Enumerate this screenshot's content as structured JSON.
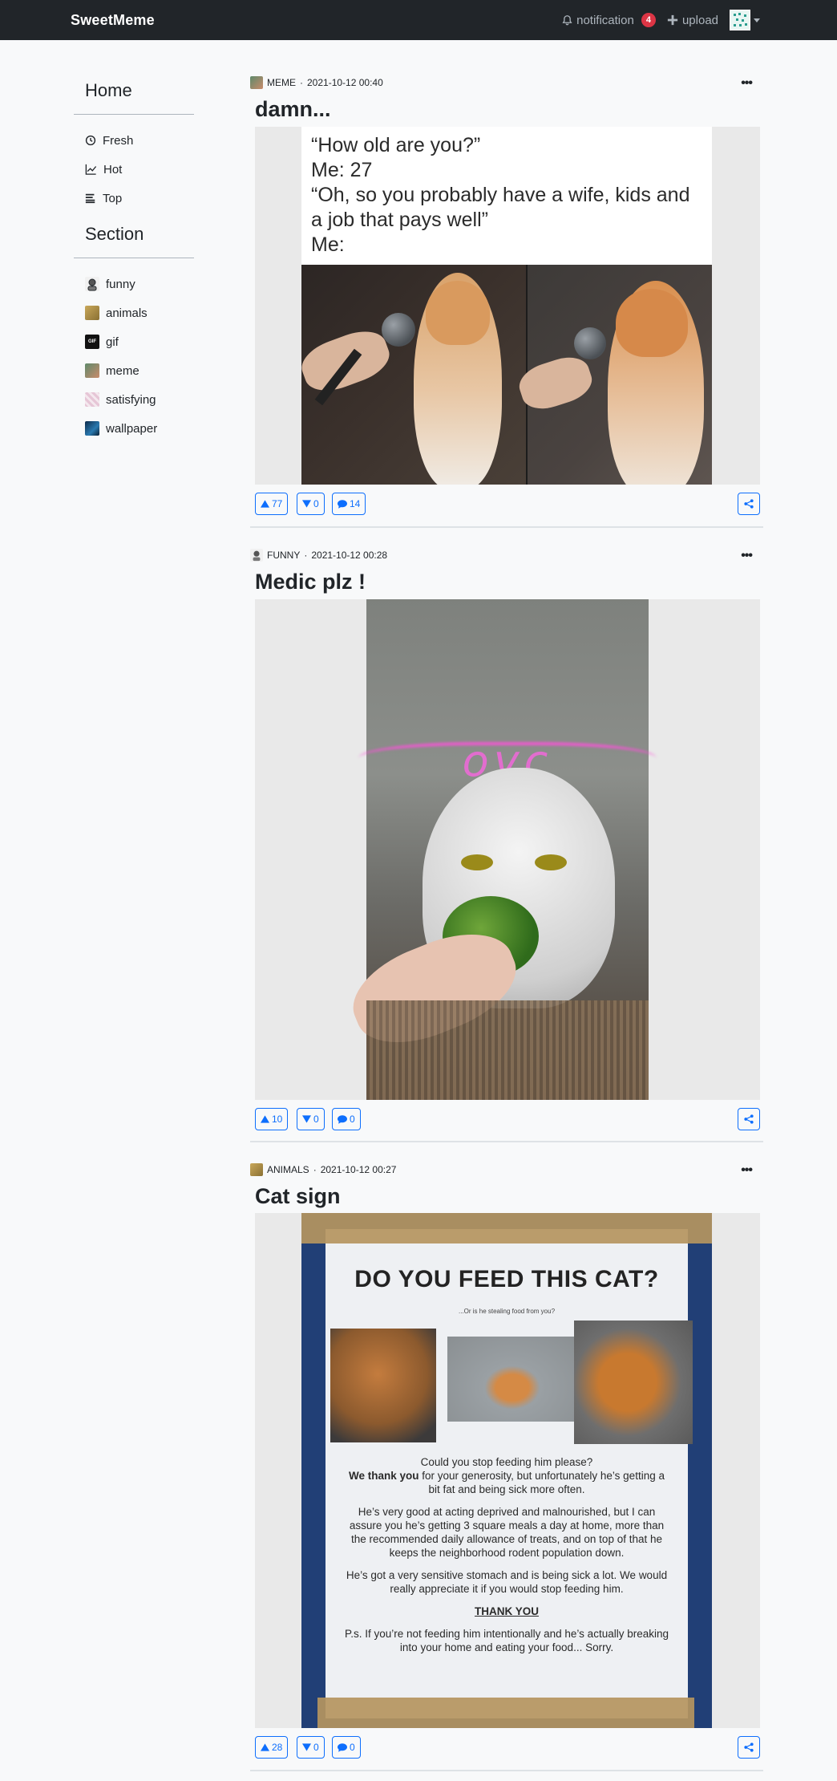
{
  "navbar": {
    "brand": "SweetMeme",
    "notification_label": "notification",
    "notification_count": "4",
    "upload_label": "upload"
  },
  "sidebar": {
    "home_heading": "Home",
    "home_items": [
      {
        "label": "Fresh",
        "icon": "clock-icon"
      },
      {
        "label": "Hot",
        "icon": "chart-line-icon"
      },
      {
        "label": "Top",
        "icon": "list-icon"
      }
    ],
    "section_heading": "Section",
    "sections": [
      {
        "label": "funny",
        "color": "#d9d9d9"
      },
      {
        "label": "animals",
        "color": "#c9a85a"
      },
      {
        "label": "gif",
        "color": "#111111"
      },
      {
        "label": "meme",
        "color": "#5f8a6b"
      },
      {
        "label": "satisfying",
        "color": "#e6c6d6"
      },
      {
        "label": "wallpaper",
        "color": "#1f4f7a"
      }
    ]
  },
  "posts": [
    {
      "section": "MEME",
      "section_color": "#5f8a6b",
      "date": "2021-10-12 00:40",
      "title": "damn...",
      "upvotes": "77",
      "downvotes": "0",
      "comments": "14",
      "meme_lines": [
        "“How old are you?”",
        "Me: 27",
        "“Oh, so you probably have a wife, kids and",
        "a job that pays well”",
        "Me:"
      ]
    },
    {
      "section": "FUNNY",
      "section_color": "#d9d9d9",
      "date": "2021-10-12 00:28",
      "title": "Medic plz !",
      "upvotes": "10",
      "downvotes": "0",
      "comments": "0"
    },
    {
      "section": "ANIMALS",
      "section_color": "#c9a85a",
      "date": "2021-10-12 00:27",
      "title": "Cat sign",
      "upvotes": "28",
      "downvotes": "0",
      "comments": "0",
      "sign": {
        "heading": "DO YOU FEED THIS CAT?",
        "subheading": "...Or is he stealing food from you?",
        "para1_a": "Could you stop feeding him please?",
        "para1_bold": "We thank you",
        "para1_b": " for your generosity, but unfortunately he’s getting a bit fat and being sick more often.",
        "para2": "He’s very good at acting deprived and malnourished, but I can assure you he’s getting 3 square meals a day at home, more than the recommended daily allowance of treats, and on top of that he keeps the neighborhood rodent population down.",
        "para3": "He’s got a very sensitive stomach and is being sick a lot. We would really appreciate it if you would stop feeding him.",
        "thanks": "THANK YOU",
        "ps": "P.s. If you’re not feeding him intentionally and he’s actually breaking into your home and eating your food... Sorry."
      }
    }
  ]
}
